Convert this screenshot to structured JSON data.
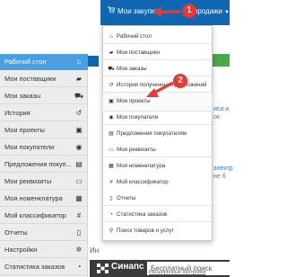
{
  "navbar": {
    "purchases_label": "Мои закупки",
    "sales_label": "продажи"
  },
  "sidebar": {
    "items": [
      {
        "label": "Рабочий стол",
        "icon": "home-icon"
      },
      {
        "label": "Мои поставщики",
        "icon": "truck-icon"
      },
      {
        "label": "Мои заказы",
        "icon": "cart-icon"
      },
      {
        "label": "История",
        "icon": "history-icon"
      },
      {
        "label": "Мои проекты",
        "icon": "briefcase-icon"
      },
      {
        "label": "Мои покупатели",
        "icon": "eye-icon"
      },
      {
        "label": "Предложения покуп...",
        "icon": "document-icon"
      },
      {
        "label": "Мои реквизиты",
        "icon": "id-card-icon"
      },
      {
        "label": "Моя номенклатура",
        "icon": "grid-icon"
      },
      {
        "label": "Мой классификатор",
        "icon": "hash-icon"
      },
      {
        "label": "Отчеты",
        "icon": "file-icon"
      },
      {
        "label": "Настройки",
        "icon": "gear-icon"
      },
      {
        "label": "Статистика заказов",
        "icon": "pie-chart-icon"
      }
    ]
  },
  "dropdown": {
    "items": [
      {
        "label": "Рабочий стол",
        "icon": "home-icon"
      },
      {
        "label": "Мои поставщики",
        "icon": "truck-icon"
      },
      {
        "label": "Мои заказы",
        "icon": "cart-icon"
      },
      {
        "label": "История полученных предложений",
        "icon": "history-icon"
      },
      {
        "label": "Мои проекты",
        "icon": "briefcase-icon"
      },
      {
        "label": "Мои покупатели",
        "icon": "eye-icon"
      },
      {
        "label": "Предложения покупателям",
        "icon": "document-icon"
      },
      {
        "label": "Мои реквизиты",
        "icon": "id-card-icon"
      },
      {
        "label": "Моя номенклатура",
        "icon": "grid-icon"
      },
      {
        "label": "Мой классификатор",
        "icon": "hash-icon"
      },
      {
        "label": "Отчеты",
        "icon": "file-icon"
      },
      {
        "label": "Статистика заказов",
        "icon": "pie-chart-icon"
      },
      {
        "label": "Поиск товаров и услуг",
        "icon": "search-icon"
      }
    ]
  },
  "background": {
    "partial_text_1": "иси и",
    "partial_text_2": "ок",
    "partial_text_3": "электр",
    "partial_text_4": "не б",
    "partial_heading": "Ин"
  },
  "sinaps": {
    "brand": "Синапс",
    "search_value": "Бесплатный поиск",
    "sub_link": "Расширенные настройки"
  },
  "annotations": {
    "step1": "1",
    "step2": "2"
  },
  "colors": {
    "navbar": "#0f67b1",
    "sidebar_active": "#4a9fe0",
    "marker": "#e53935"
  }
}
